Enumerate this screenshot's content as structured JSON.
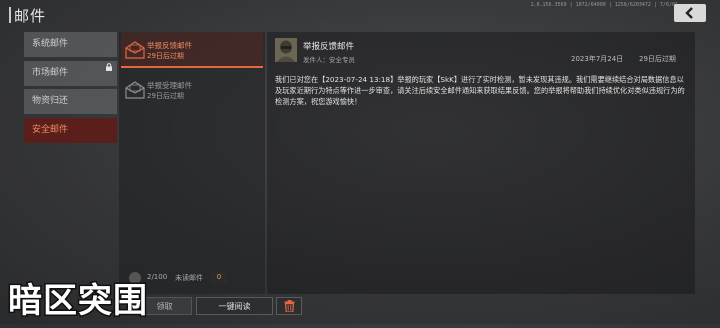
{
  "header": {
    "title": "邮件",
    "sysinfo": "1.0.156.3569 | 1072/64000 | 1258/6203472 | 7/6/01"
  },
  "sidebar": {
    "items": [
      {
        "label": "系统邮件",
        "active": false,
        "locked": false
      },
      {
        "label": "市场邮件",
        "active": false,
        "locked": true
      },
      {
        "label": "物资归还",
        "active": false,
        "locked": false
      },
      {
        "label": "安全邮件",
        "active": true,
        "locked": false
      }
    ]
  },
  "mail_list": [
    {
      "title": "举报反馈邮件",
      "sub": "29日后过期",
      "selected": true
    },
    {
      "title": "举报受理邮件",
      "sub": "29日后过期",
      "selected": false
    }
  ],
  "list_footer": {
    "count": "2/100",
    "unread_label": "未读邮件",
    "unread_count": "0"
  },
  "detail": {
    "title": "举报反馈邮件",
    "sender": "发件人：安全专员",
    "date": "2023年7月24日",
    "expire": "29日后过期",
    "body": "我们已对您在【2023-07-24 13:18】举报的玩家【SkK】进行了实时检测，暂未发现其违规。我们需要继续结合对局数据信息以及玩家近期行为特点等作进一步审查，请关注后续安全邮件通知来获取结果反馈。您的举报将帮助我们持续优化对类似违规行为的检测方案，祝您游戏愉快！"
  },
  "buttons": {
    "claim": "领取",
    "read_all": "一键阅读"
  },
  "watermark": "暗区突围",
  "colors": {
    "accent": "#e3673f",
    "active_bg": "#5a1f1a",
    "badge": "#e6a13b"
  }
}
